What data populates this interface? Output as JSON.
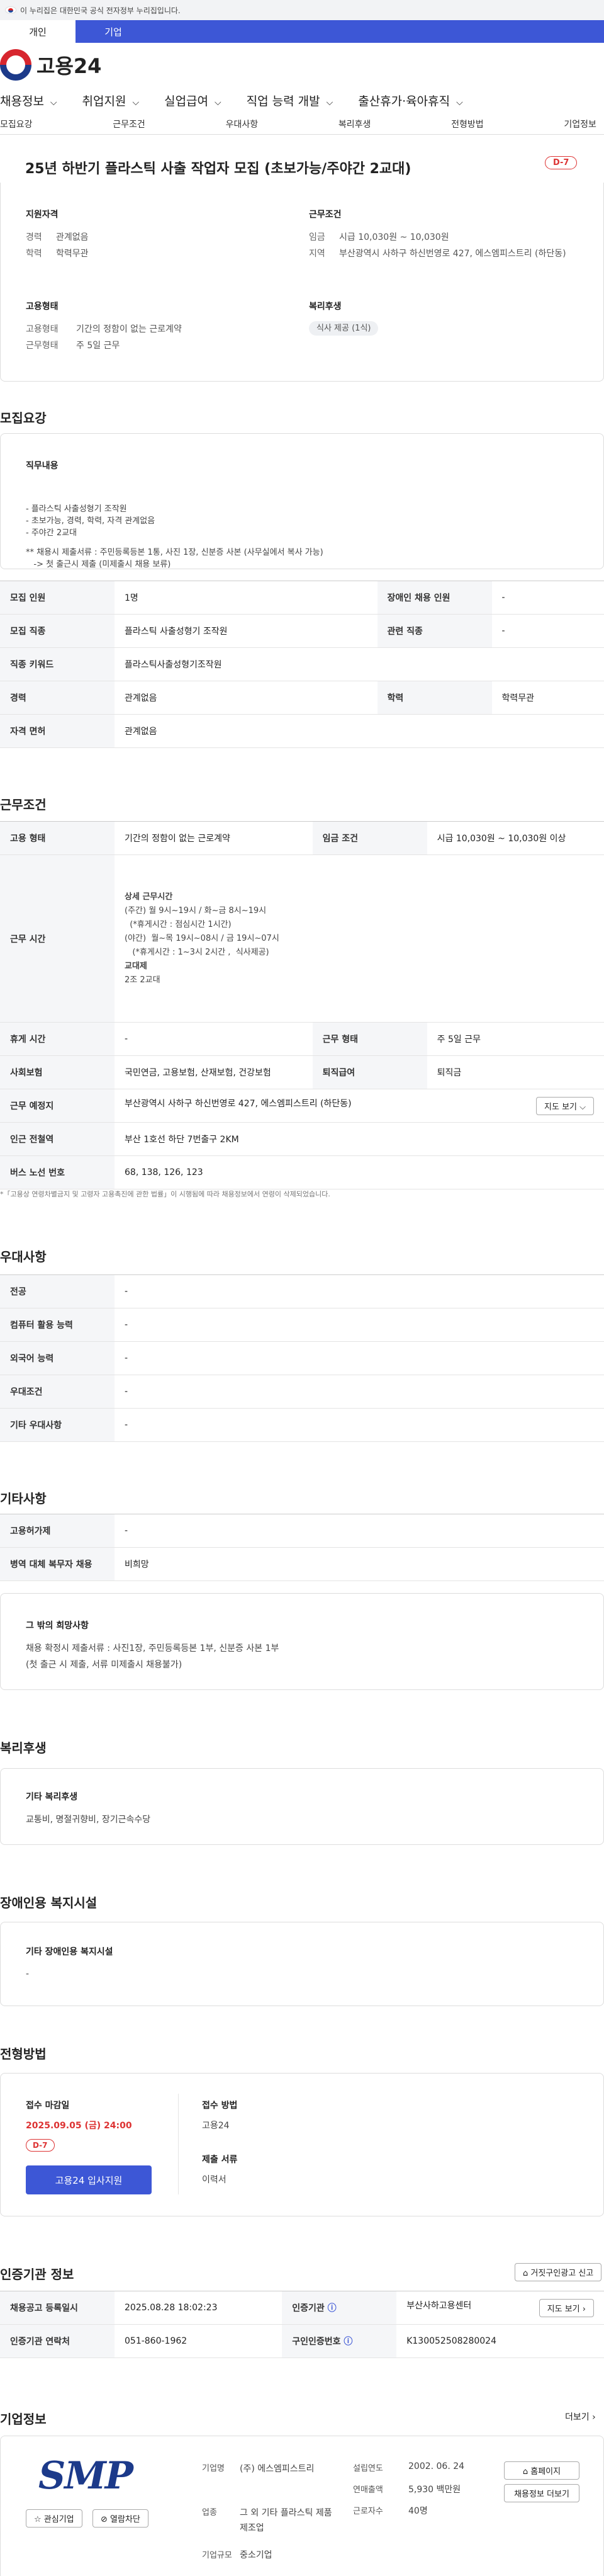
{
  "topbar": {
    "text": "이 누리집은 대한민국 공식 전자정부 누리집입니다."
  },
  "usertabs": [
    "개인",
    "기업"
  ],
  "logo": {
    "name": "고용24"
  },
  "gnb": [
    "채용정보",
    "취업지원",
    "실업급여",
    "직업 능력 개발",
    "출산휴가·육아휴직"
  ],
  "subtabs": [
    "모집요강",
    "근무조건",
    "우대사항",
    "복리후생",
    "전형방법",
    "기업정보"
  ],
  "job": {
    "title": "25년 하반기 플라스틱 사출 작업자 모집 (초보가능/주야간 2교대)",
    "dday": "D-7"
  },
  "summary": {
    "qual_title": "지원자격",
    "career_k": "경력",
    "career_v": "관계없음",
    "edu_k": "학력",
    "edu_v": "학력무관",
    "cond_title": "근무조건",
    "wage_k": "임금",
    "wage_v": "시급 10,030원 ~ 10,030원",
    "loc_k": "지역",
    "loc_v": "부산광역시 사하구 하신번영로 427, 에스엠피스트리 (하단동)",
    "emp_title": "고용형태",
    "emptype_k": "고용형태",
    "emptype_v": "기간의 정함이 없는 근로계약",
    "worktype_k": "근무형태",
    "worktype_v": "주 5일 근무",
    "welfare_title": "복리후생",
    "welfare_badge": "식사 제공 (1식)"
  },
  "recruit": {
    "title": "모집요강",
    "duty_title": "직무내용",
    "duty_lines": [
      "- 플라스틱 사출성형기 조작원",
      "- 초보가능, 경력, 학력, 자격 관계없음",
      "- 주야간 2교대",
      "",
      "** 채용시 제출서류 : 주민등록등본 1통, 사진 1장, 신분증 사본 (사무실에서 복사 가능)",
      "   -> 첫 출근시 제출 (미제출시 채용 보류)"
    ],
    "rows": [
      [
        "모집 인원",
        "1명",
        "장애인 채용 인원",
        "-"
      ],
      [
        "모집 직종",
        "플라스틱 사출성형기 조작원",
        "관련 직종",
        "-"
      ],
      [
        "직종 키워드",
        "플라스틱사출성형기조작원"
      ],
      [
        "경력",
        "관계없음",
        "학력",
        "학력무관"
      ],
      [
        "자격 면허",
        "관계없음"
      ]
    ]
  },
  "work": {
    "title": "근무조건",
    "emp_k": "고용 형태",
    "emp_v": "기간의 정함이 없는 근로계약",
    "wage_k": "임금 조건",
    "wage_v": "시급 10,030원 ~ 10,030원 이상",
    "time_k": "근무 시간",
    "time_head": "상세 근무시간",
    "time_lines": [
      "(주간) 월 9시~19시 / 화~금 8시~19시",
      "  (*휴게시간 : 점심시간 1시간)",
      "(야간)  월~목 19시~08시 / 금 19시~07시",
      "   (*휴게시간 : 1~3시 2시간 ,  식사제공)"
    ],
    "shift_head": "교대제",
    "shift_v": "2조 2교대",
    "rest_k": "휴게 시간",
    "rest_v": "-",
    "form_k": "근무 형태",
    "form_v": "주 5일 근무",
    "ins_k": "사회보험",
    "ins_v": "국민연금, 고용보험, 산재보험, 건강보험",
    "sev_k": "퇴직급여",
    "sev_v": "퇴직금",
    "place_k": "근무 예정지",
    "place_v": "부산광역시 사하구 하신번영로 427, 에스엠피스트리 (하단동)",
    "map_btn": "지도 보기",
    "station_k": "인근 전철역",
    "station_v": "부산 1호선 하단 7번출구 2KM",
    "bus_k": "버스 노선 번호",
    "bus_v": "68, 138, 126, 123",
    "note": "*「고용상 연령차별금지 및 고령자 고용촉진에 관한 법률」이 시행됨에 따라 채용정보에서 연령이 삭제되었습니다."
  },
  "pref": {
    "title": "우대사항",
    "rows": [
      [
        "전공",
        "-"
      ],
      [
        "컴퓨터 활용 능력",
        "-"
      ],
      [
        "외국어 능력",
        "-"
      ],
      [
        "우대조건",
        "-"
      ],
      [
        "기타 우대사항",
        "-"
      ]
    ]
  },
  "etc": {
    "title": "기타사항",
    "rows": [
      [
        "고용허가제",
        "-"
      ],
      [
        "병역 대체 복무자 채용",
        "비희망"
      ]
    ],
    "other_title": "그 밖의 희망사항",
    "other_lines": [
      "채용 확정시 제출서류 : 사진1장, 주민등록등본 1부, 신분증 사본 1부",
      "(첫 출근 시 제출, 서류 미제출시 채용불가)"
    ]
  },
  "benefit": {
    "title": "복리후생",
    "sub": "기타 복리후생",
    "val": "교통비, 명절귀향비, 장기근속수당"
  },
  "disabled": {
    "title": "장애인용 복지시설",
    "sub": "기타 장애인용 복지시설",
    "val": "-"
  },
  "process": {
    "title": "전형방법",
    "deadline_k": "접수 마감일",
    "deadline_v": "2025.09.05 (금) 24:00",
    "dday": "D-7",
    "apply_btn": "고용24 입사지원",
    "method_k": "접수 방법",
    "method_v": "고용24",
    "docs_k": "제출 서류",
    "docs_v": "이력서"
  },
  "agency": {
    "title": "인증기관 정보",
    "report_btn": "거짓구인광고 신고",
    "reg_k": "채용공고 등록일시",
    "reg_v": "2025.08.28 18:02:23",
    "org_k": "인증기관",
    "org_v": "부산사하고용센터",
    "map_btn": "지도 보기",
    "tel_k": "인증기관 연락처",
    "tel_v": "051-860-1962",
    "no_k": "구인인증번호",
    "no_v": "K130052508280024"
  },
  "company": {
    "title": "기업정보",
    "more": "더보기",
    "logo_text": "SMP",
    "fav_btn": "관심기업",
    "block_btn": "열람차단",
    "name_k": "기업명",
    "name_v": "(주) 에스엠피스트리",
    "ind_k": "업종",
    "ind_v": "그 외 기타 플라스틱 제품 제조업",
    "size_k": "기업규모",
    "size_v": "중소기업",
    "est_k": "설립연도",
    "est_v": "2002. 06. 24",
    "sales_k": "연매출액",
    "sales_v": "5,930 백만원",
    "emp_k": "근로자수",
    "emp_v": "40명",
    "home_btn": "홈페이지",
    "list_btn": "채용정보 더보기"
  }
}
